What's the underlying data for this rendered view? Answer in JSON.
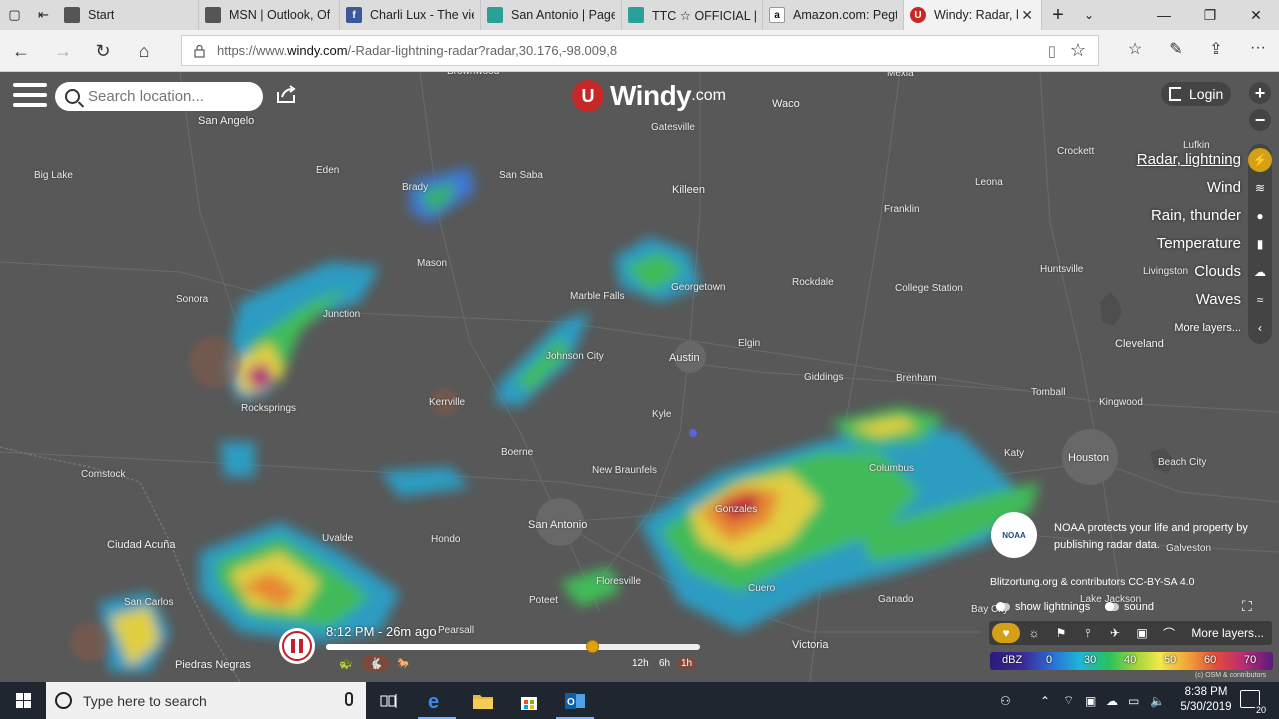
{
  "browser": {
    "tabs": [
      {
        "title": "Start",
        "favicon": "msn-icon",
        "color": "#555555"
      },
      {
        "title": "MSN | Outlook, Of",
        "favicon": "msn-icon",
        "color": "#555555"
      },
      {
        "title": "Charli Lux - The vie",
        "favicon": "facebook-icon",
        "color": "#3b5998"
      },
      {
        "title": "San Antonio | Page",
        "favicon": "page-icon",
        "color": "#2aa198"
      },
      {
        "title": "TTC ☆ OFFICIAL | F",
        "favicon": "page-icon",
        "color": "#2aa198"
      },
      {
        "title": "Amazon.com: Pegt",
        "favicon": "amazon-icon",
        "color": "#ffffff"
      },
      {
        "title": "Windy: Radar, l",
        "favicon": "windy-icon",
        "color": "#c62828",
        "active": true
      }
    ],
    "url_prefix": "https://www.",
    "url_domain": "windy.com",
    "url_rest": "/-Radar-lightning-radar?radar,30.176,-98.009,8"
  },
  "windy": {
    "search_placeholder": "Search location...",
    "logo_word": "Windy",
    "logo_domain": ".com",
    "login_label": "Login",
    "zoom_in": "+",
    "zoom_out": "−",
    "layers": [
      {
        "label": "Radar, lightning",
        "active": true
      },
      {
        "label": "Wind"
      },
      {
        "label": "Rain, thunder"
      },
      {
        "label": "Temperature"
      },
      {
        "label": "Clouds"
      },
      {
        "label": "Waves"
      },
      {
        "label": "More layers...",
        "more": true
      }
    ],
    "noaa_badge": "NOAA",
    "noaa_text": "NOAA protects your life and property by publishing radar data.",
    "credit": "Blitzortung.org & contributors CC-BY-SA 4.0",
    "show_lightnings": "show lightnings",
    "sound": "sound",
    "more_layers_bar": "More layers...",
    "legend_unit": "dBZ",
    "legend_values": [
      "0",
      "30",
      "40",
      "50",
      "60",
      "70"
    ],
    "osm_credit": "(c) OSM & contributors",
    "time_label": "8:12 PM - 26m ago",
    "timeline_progress": 0.71,
    "ranges": [
      "12h",
      "6h",
      "1h"
    ],
    "active_range": "1h"
  },
  "map_labels": [
    {
      "name": "Brownwood"
    },
    {
      "name": "Mexia"
    },
    {
      "name": "San Angelo",
      "big": true
    },
    {
      "name": "Waco",
      "big": true
    },
    {
      "name": "Gatesville"
    },
    {
      "name": "Lufkin"
    },
    {
      "name": "Crockett"
    },
    {
      "name": "Big Lake"
    },
    {
      "name": "Eden"
    },
    {
      "name": "Brady"
    },
    {
      "name": "San Saba"
    },
    {
      "name": "Killeen",
      "big": true
    },
    {
      "name": "Leona"
    },
    {
      "name": "Franklin"
    },
    {
      "name": "Mason"
    },
    {
      "name": "Sonora"
    },
    {
      "name": "Junction"
    },
    {
      "name": "Marble Falls"
    },
    {
      "name": "Georgetown"
    },
    {
      "name": "Rockdale"
    },
    {
      "name": "College Station"
    },
    {
      "name": "Huntsville"
    },
    {
      "name": "Livingston"
    },
    {
      "name": "Cleveland",
      "big": true
    },
    {
      "name": "Johnson City"
    },
    {
      "name": "Austin",
      "big": true
    },
    {
      "name": "Elgin"
    },
    {
      "name": "Giddings"
    },
    {
      "name": "Brenham"
    },
    {
      "name": "Tomball"
    },
    {
      "name": "Kingwood"
    },
    {
      "name": "Rocksprings"
    },
    {
      "name": "Kerrville"
    },
    {
      "name": "Kyle"
    },
    {
      "name": "Comstock"
    },
    {
      "name": "Boerne"
    },
    {
      "name": "New Braunfels"
    },
    {
      "name": "Columbus"
    },
    {
      "name": "Katy"
    },
    {
      "name": "Houston",
      "big": true
    },
    {
      "name": "Beach City"
    },
    {
      "name": "Gonzales"
    },
    {
      "name": "Ciudad Acuña",
      "big": true
    },
    {
      "name": "San Antonio",
      "big": true
    },
    {
      "name": "Uvalde"
    },
    {
      "name": "Hondo"
    },
    {
      "name": "Galveston"
    },
    {
      "name": "Floresville"
    },
    {
      "name": "San Carlos"
    },
    {
      "name": "Pearsall"
    },
    {
      "name": "Poteet"
    },
    {
      "name": "Cuero"
    },
    {
      "name": "Ganado"
    },
    {
      "name": "Bay City"
    },
    {
      "name": "Lake Jackson"
    },
    {
      "name": "Piedras Negras",
      "big": true
    },
    {
      "name": "Victoria",
      "big": true
    }
  ],
  "taskbar": {
    "search_placeholder": "Type here to search",
    "time": "8:38 PM",
    "date": "5/30/2019",
    "notifications": "20"
  }
}
